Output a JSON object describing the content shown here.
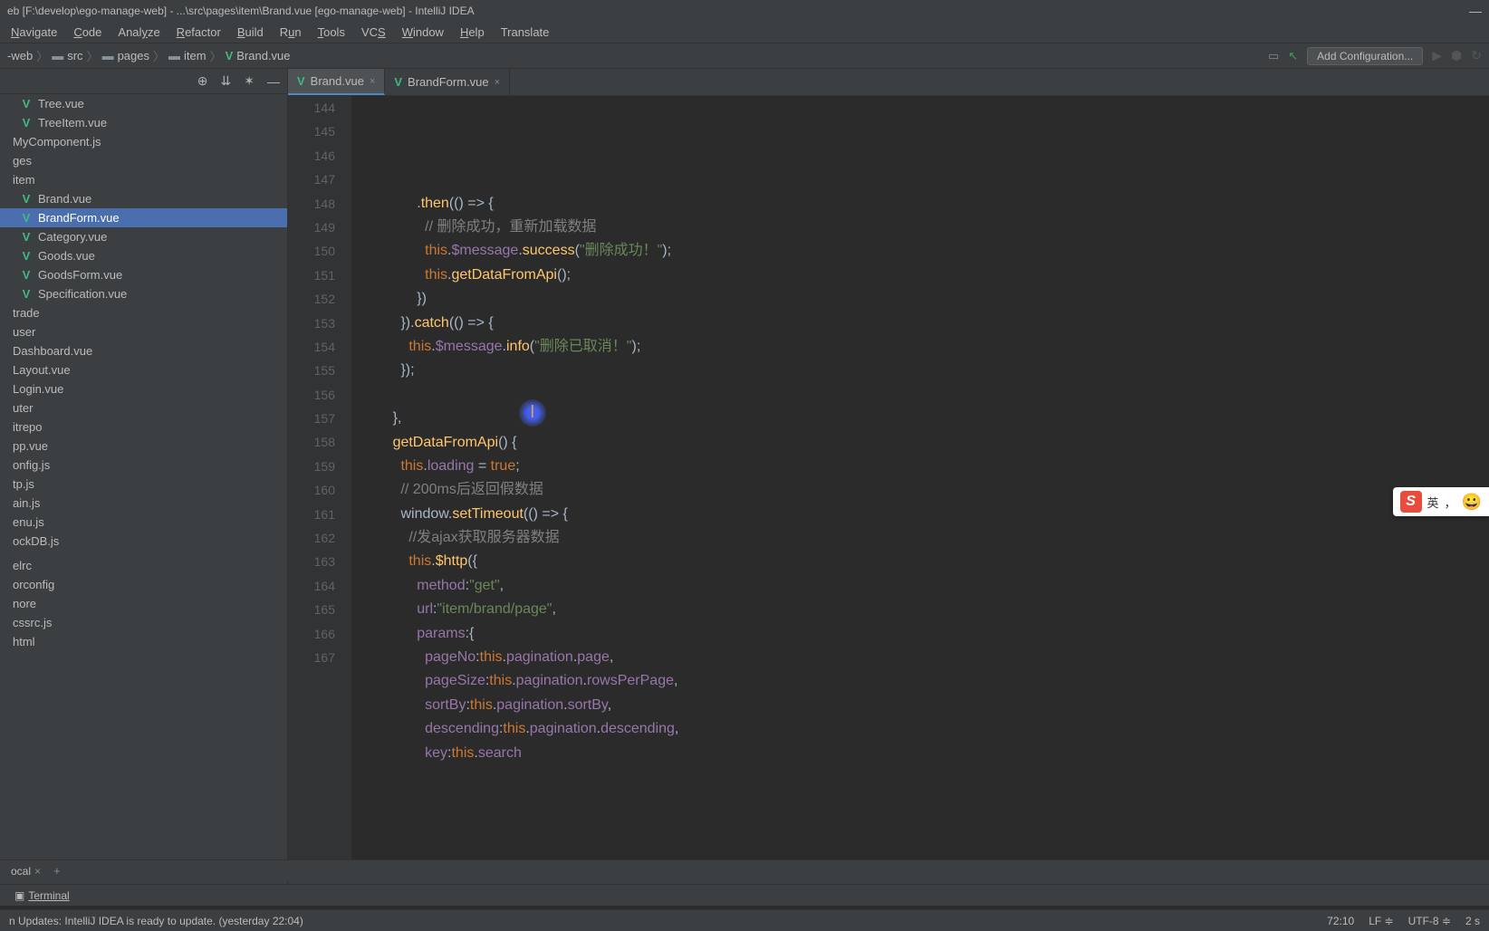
{
  "title": "eb [F:\\develop\\ego-manage-web] - ...\\src\\pages\\item\\Brand.vue [ego-manage-web] - IntelliJ IDEA",
  "menu": [
    "Navigate",
    "Code",
    "Analyze",
    "Refactor",
    "Build",
    "Run",
    "Tools",
    "VCS",
    "Window",
    "Help",
    "Translate"
  ],
  "menuUnderline": [
    0,
    0,
    4,
    0,
    0,
    1,
    0,
    2,
    0,
    0,
    -1
  ],
  "breadcrumb": {
    "root": "-web",
    "items": [
      "src",
      "pages",
      "item",
      "Brand.vue"
    ]
  },
  "addConfig": "Add Configuration...",
  "projectTree": [
    {
      "label": "Tree.vue",
      "icon": "V",
      "iconClass": "vue-icon",
      "indent": 1
    },
    {
      "label": "TreeItem.vue",
      "icon": "V",
      "iconClass": "vue-icon",
      "indent": 1
    },
    {
      "label": "MyComponent.js",
      "icon": "",
      "iconClass": "",
      "indent": 0
    },
    {
      "label": "ges",
      "icon": "",
      "iconClass": "",
      "indent": 0
    },
    {
      "label": "item",
      "icon": "",
      "iconClass": "",
      "indent": 0
    },
    {
      "label": "Brand.vue",
      "icon": "V",
      "iconClass": "vue-icon",
      "indent": 1
    },
    {
      "label": "BrandForm.vue",
      "icon": "V",
      "iconClass": "vue-icon",
      "indent": 1,
      "selected": true
    },
    {
      "label": "Category.vue",
      "icon": "V",
      "iconClass": "vue-icon",
      "indent": 1
    },
    {
      "label": "Goods.vue",
      "icon": "V",
      "iconClass": "vue-icon",
      "indent": 1
    },
    {
      "label": "GoodsForm.vue",
      "icon": "V",
      "iconClass": "vue-icon",
      "indent": 1
    },
    {
      "label": "Specification.vue",
      "icon": "V",
      "iconClass": "vue-icon",
      "indent": 1
    },
    {
      "label": "trade",
      "icon": "",
      "iconClass": "",
      "indent": 0
    },
    {
      "label": "user",
      "icon": "",
      "iconClass": "",
      "indent": 0
    },
    {
      "label": "Dashboard.vue",
      "icon": "",
      "iconClass": "",
      "indent": 0
    },
    {
      "label": "Layout.vue",
      "icon": "",
      "iconClass": "",
      "indent": 0
    },
    {
      "label": "Login.vue",
      "icon": "",
      "iconClass": "",
      "indent": 0
    },
    {
      "label": "uter",
      "icon": "",
      "iconClass": "",
      "indent": 0
    },
    {
      "label": "itrepo",
      "icon": "",
      "iconClass": "",
      "indent": 0
    },
    {
      "label": "pp.vue",
      "icon": "",
      "iconClass": "",
      "indent": 0
    },
    {
      "label": "onfig.js",
      "icon": "",
      "iconClass": "",
      "indent": 0
    },
    {
      "label": "tp.js",
      "icon": "",
      "iconClass": "",
      "indent": 0
    },
    {
      "label": "ain.js",
      "icon": "",
      "iconClass": "",
      "indent": 0
    },
    {
      "label": "enu.js",
      "icon": "",
      "iconClass": "",
      "indent": 0
    },
    {
      "label": "ockDB.js",
      "icon": "",
      "iconClass": "",
      "indent": 0
    },
    {
      "label": "",
      "icon": "",
      "iconClass": "",
      "indent": 0
    },
    {
      "label": "elrc",
      "icon": "",
      "iconClass": "",
      "indent": 0
    },
    {
      "label": "orconfig",
      "icon": "",
      "iconClass": "",
      "indent": 0
    },
    {
      "label": "nore",
      "icon": "",
      "iconClass": "",
      "indent": 0
    },
    {
      "label": "cssrc.js",
      "icon": "",
      "iconClass": "",
      "indent": 0
    },
    {
      "label": "html",
      "icon": "",
      "iconClass": "",
      "indent": 0
    }
  ],
  "bottomTabLocal": "ocal",
  "editorTabs": [
    {
      "label": "Brand.vue",
      "active": true
    },
    {
      "label": "BrandForm.vue",
      "active": false
    }
  ],
  "lineStart": 144,
  "lineEnd": 167,
  "codeLines": [
    {
      "n": 144,
      "html": "              .<span class='method'>then</span>(() => {"
    },
    {
      "n": 145,
      "html": "                <span class='com'>// 删除成功，重新加载数据</span>"
    },
    {
      "n": 146,
      "html": "                <span class='this'>this</span>.<span class='field'>$message</span>.<span class='method'>success</span>(<span class='str'>\"删除成功！\"</span>);"
    },
    {
      "n": 147,
      "html": "                <span class='this'>this</span>.<span class='method'>getDataFromApi</span>();"
    },
    {
      "n": 148,
      "html": "              })"
    },
    {
      "n": 149,
      "html": "          }).<span class='method'>catch</span>(() => {"
    },
    {
      "n": 150,
      "html": "            <span class='this'>this</span>.<span class='field'>$message</span>.<span class='method'>info</span>(<span class='str'>\"删除已取消！\"</span>);"
    },
    {
      "n": 151,
      "html": "          });"
    },
    {
      "n": 152,
      "html": ""
    },
    {
      "n": 153,
      "html": "        },"
    },
    {
      "n": 154,
      "html": "        <span class='method'>getDataFromApi</span>() {"
    },
    {
      "n": 155,
      "html": "          <span class='this'>this</span>.<span class='field'>loading</span> = <span class='kw'>true</span>;"
    },
    {
      "n": 156,
      "html": "          <span class='com'>// 200ms后返回假数据</span>"
    },
    {
      "n": 157,
      "html": "          window.<span class='method'>setTimeout</span>(() => {"
    },
    {
      "n": 158,
      "html": "            <span class='com'>//发ajax获取服务器数据</span>"
    },
    {
      "n": 159,
      "html": "            <span class='this'>this</span>.<span class='method'>$http</span>({"
    },
    {
      "n": 160,
      "html": "              <span class='field'>method</span>:<span class='str'>\"get\"</span>,"
    },
    {
      "n": 161,
      "html": "              <span class='field'>url</span>:<span class='str'>\"item/brand/page\"</span>,"
    },
    {
      "n": 162,
      "html": "              <span class='field'>params</span>:{"
    },
    {
      "n": 163,
      "html": "                <span class='field'>pageNo</span>:<span class='this'>this</span>.<span class='field'>pagination</span>.<span class='field'>page</span>,"
    },
    {
      "n": 164,
      "html": "                <span class='field'>pageSize</span>:<span class='this'>this</span>.<span class='field'>pagination</span>.<span class='field'>rowsPerPage</span>,"
    },
    {
      "n": 165,
      "html": "                <span class='field'>sortBy</span>:<span class='this'>this</span>.<span class='field'>pagination</span>.<span class='field'>sortBy</span>,"
    },
    {
      "n": 166,
      "html": "                <span class='field'>descending</span>:<span class='this'>this</span>.<span class='field'>pagination</span>.<span class='field'>descending</span>,"
    },
    {
      "n": 167,
      "html": "                <span class='field'>key</span>:<span class='this'>this</span>.<span class='field'>search</span>"
    }
  ],
  "breadcrumbContext": "script",
  "terminalLabel": "Terminal",
  "statusMessage": "n Updates: IntelliJ IDEA is ready to update. (yesterday 22:04)",
  "statusRight": {
    "pos": "72:10",
    "lf": "LF",
    "enc": "UTF-8",
    "spaces": "2 s"
  },
  "ime": {
    "text": "英",
    "dot": "，"
  }
}
